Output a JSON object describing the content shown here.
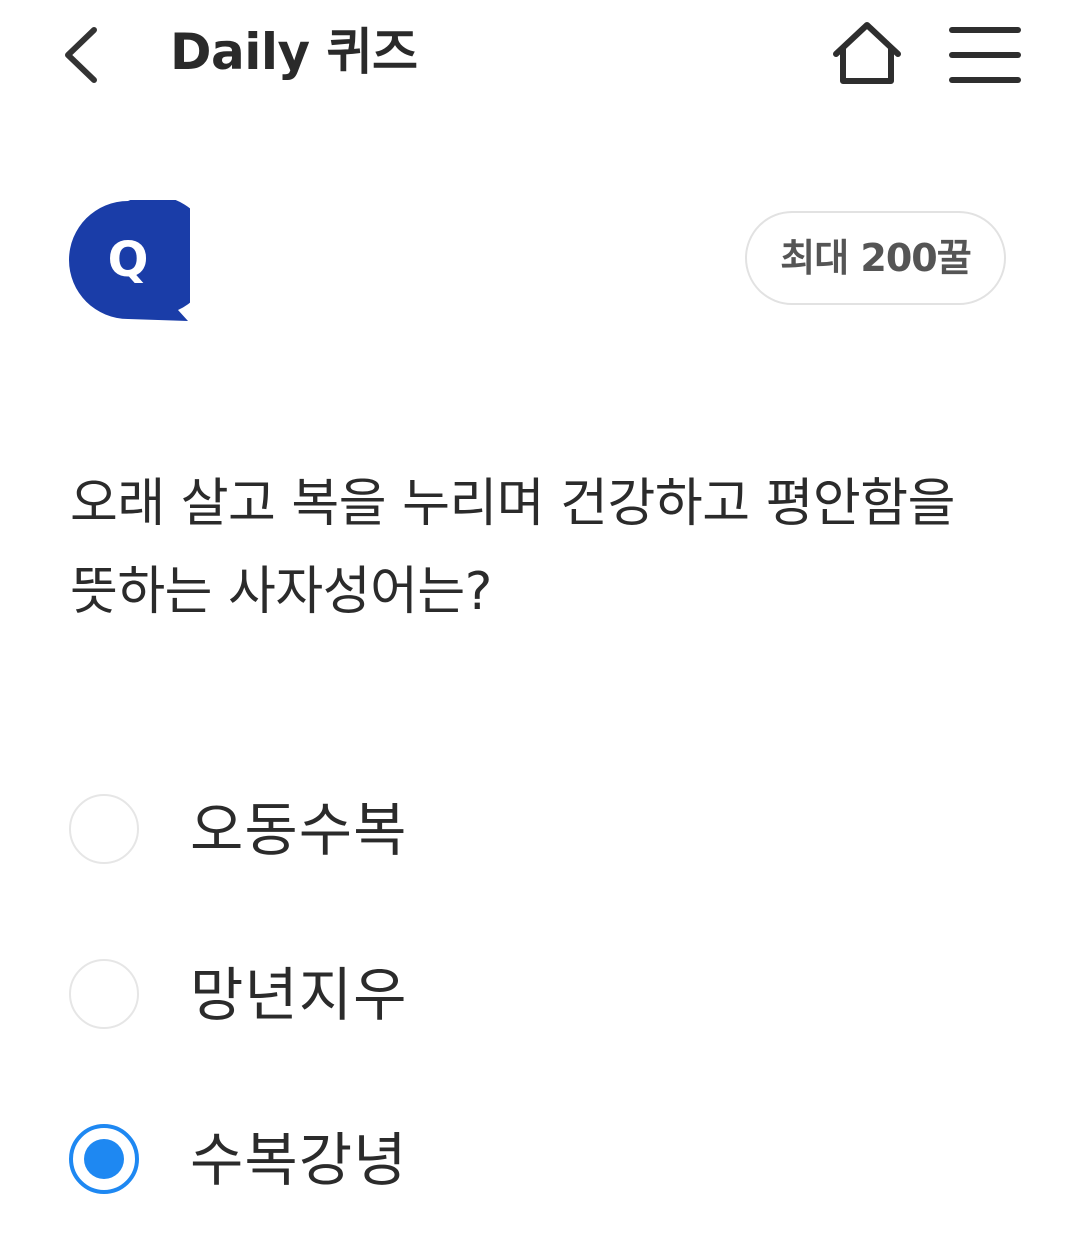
{
  "header": {
    "title": "Daily 퀴즈",
    "back_icon": "chevron-left-icon",
    "home_icon": "home-icon",
    "menu_icon": "hamburger-menu-icon"
  },
  "quiz": {
    "badge_letter": "Q",
    "badge_color": "#1a3da8",
    "reward_label": "최대 200꿀",
    "question": "오래 살고 복을 누리며 건강하고 평안함을 뜻하는 사자성어는?",
    "options": [
      {
        "label": "오동수복",
        "selected": false
      },
      {
        "label": "망년지우",
        "selected": false
      },
      {
        "label": "수복강녕",
        "selected": true
      }
    ],
    "accent_color": "#1e88f2"
  }
}
